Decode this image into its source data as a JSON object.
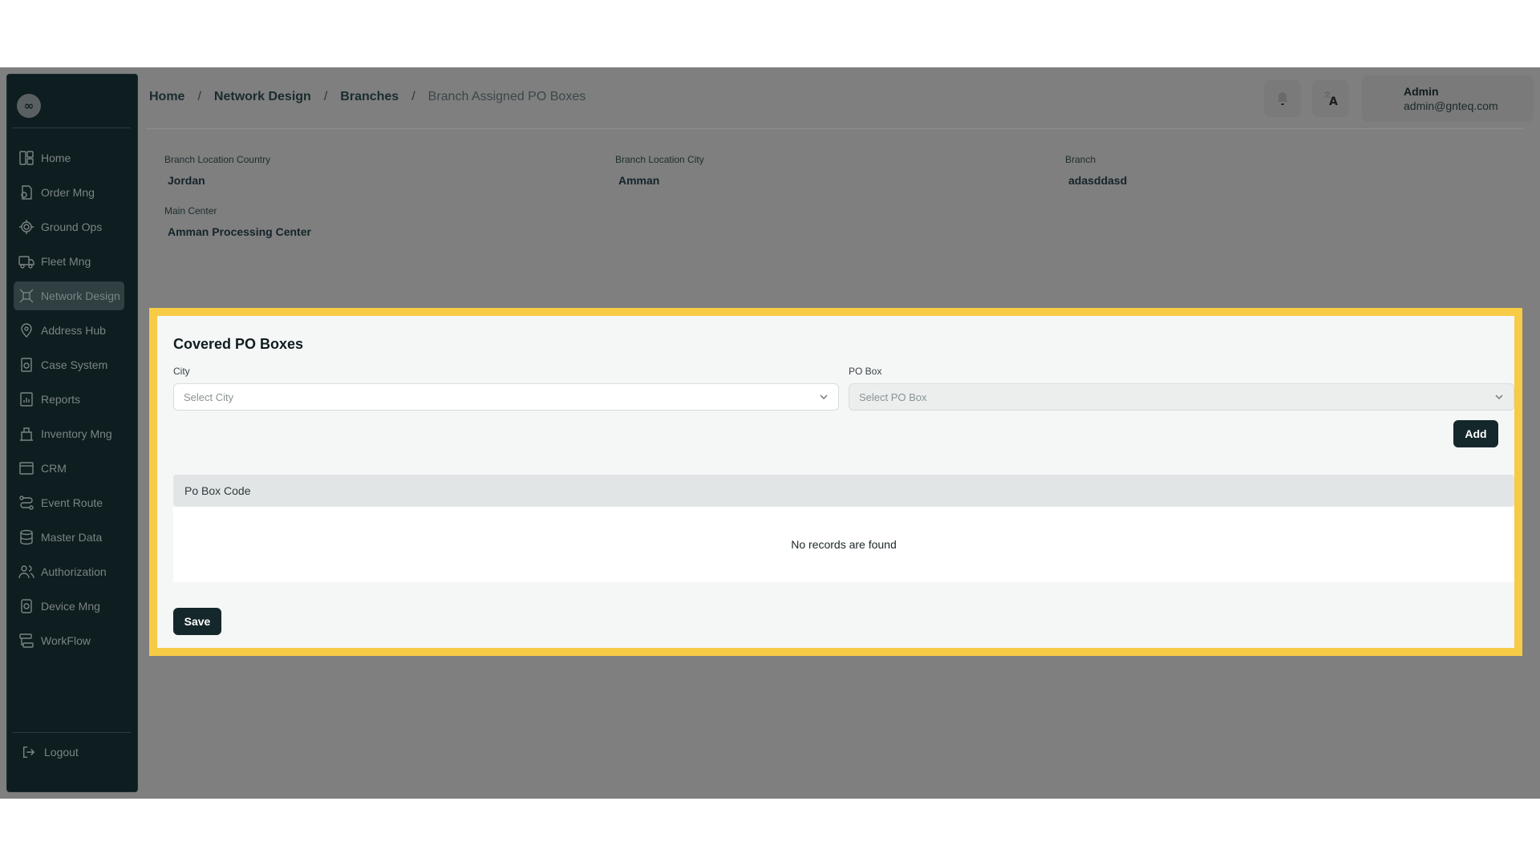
{
  "sidebar": {
    "logo_text": "∞",
    "items": [
      {
        "label": "Home",
        "icon": "home-grid-icon"
      },
      {
        "label": "Order Mng",
        "icon": "order-icon"
      },
      {
        "label": "Ground Ops",
        "icon": "ground-ops-icon"
      },
      {
        "label": "Fleet Mng",
        "icon": "truck-icon"
      },
      {
        "label": "Network Design",
        "icon": "network-icon"
      },
      {
        "label": "Address Hub",
        "icon": "location-pin-icon"
      },
      {
        "label": "Case System",
        "icon": "case-icon"
      },
      {
        "label": "Reports",
        "icon": "reports-icon"
      },
      {
        "label": "Inventory Mng",
        "icon": "inventory-icon"
      },
      {
        "label": "CRM",
        "icon": "crm-icon"
      },
      {
        "label": "Event Route",
        "icon": "route-icon"
      },
      {
        "label": "Master Data",
        "icon": "database-icon"
      },
      {
        "label": "Authorization",
        "icon": "users-icon"
      },
      {
        "label": "Device Mng",
        "icon": "device-icon"
      },
      {
        "label": "WorkFlow",
        "icon": "workflow-icon"
      }
    ],
    "active": "Network Design",
    "logout_label": "Logout"
  },
  "breadcrumb": {
    "home": "Home",
    "network_design": "Network Design",
    "branches": "Branches",
    "current": "Branch Assigned PO Boxes",
    "separator": "/"
  },
  "header": {
    "notification_icon": "bell-icon",
    "language_icon": "translate-icon",
    "user_name": "Admin",
    "user_email": "admin@gnteq.com"
  },
  "info": {
    "country_label": "Branch Location Country",
    "country_value": "Jordan",
    "city_label": "Branch Location City",
    "city_value": "Amman",
    "branch_label": "Branch",
    "branch_value": "adasddasd",
    "main_center_label": "Main Center",
    "main_center_value": "Amman Processing Center"
  },
  "card": {
    "title": "Covered PO Boxes",
    "city_label": "City",
    "city_placeholder": "Select City",
    "pobox_label": "PO Box",
    "pobox_placeholder": "Select PO Box",
    "add_label": "Add",
    "table_header": "Po Box Code",
    "empty_text": "No records are found",
    "save_label": "Save"
  },
  "colors": {
    "sidebar_bg": "#0e1d1f",
    "overlay": "#7f7f7f",
    "highlight": "#f7cb46",
    "primary_button": "#14272b"
  }
}
